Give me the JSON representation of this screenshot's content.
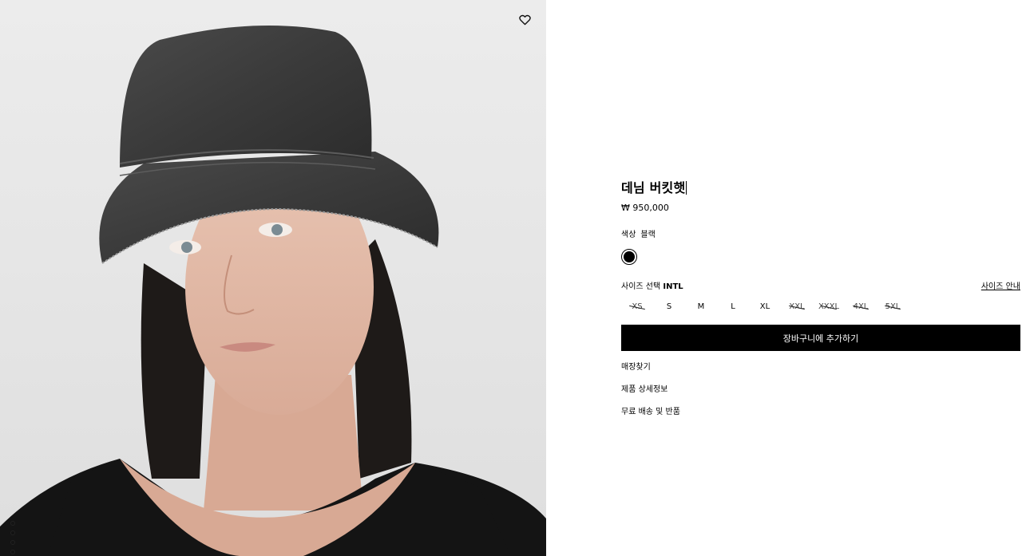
{
  "product": {
    "name": "데님 버킷햇",
    "price": "₩ 950,000"
  },
  "color": {
    "label": "색상",
    "value": "블랙",
    "swatch": "#000000"
  },
  "size": {
    "label": "사이즈 선택",
    "system": "INTL",
    "guide": "사이즈 안내",
    "options": [
      {
        "label": "XS",
        "available": false
      },
      {
        "label": "S",
        "available": true
      },
      {
        "label": "M",
        "available": true
      },
      {
        "label": "L",
        "available": true
      },
      {
        "label": "XL",
        "available": true
      },
      {
        "label": "XXL",
        "available": false
      },
      {
        "label": "XXXL",
        "available": false
      },
      {
        "label": "4XL",
        "available": false
      },
      {
        "label": "5XL",
        "available": false
      }
    ]
  },
  "cart_button": "장바구니에 추가하기",
  "links": [
    "매장찾기",
    "제품 상세정보",
    "무료 배송 및 반품"
  ],
  "gallery": {
    "dots": 4,
    "active_dot": 1
  },
  "icons": {
    "wishlist": "heart-icon"
  }
}
